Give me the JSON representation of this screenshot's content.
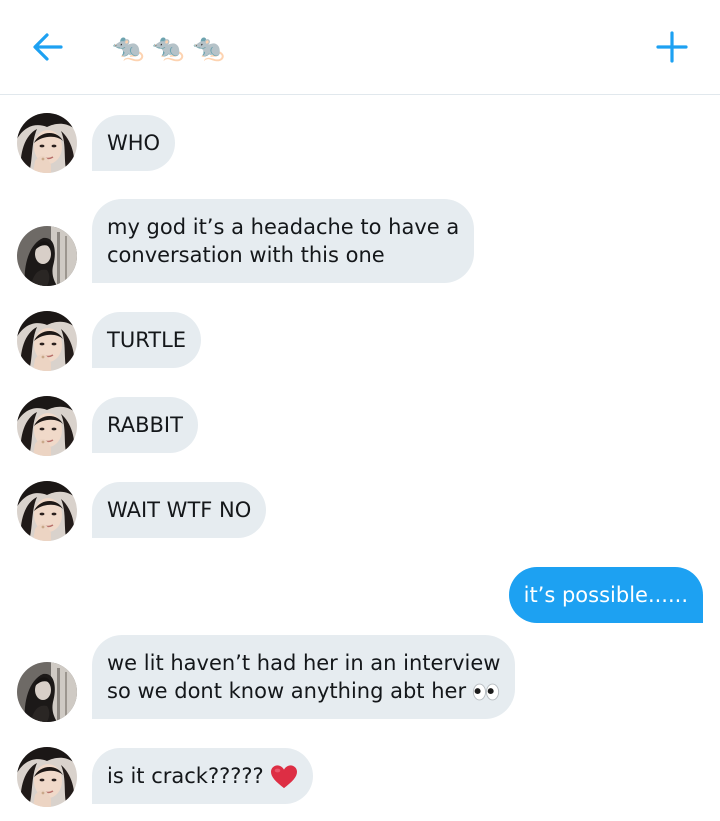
{
  "header": {
    "back_icon": "arrow-left-icon",
    "title_glyphs": [
      "🐀",
      "🐀",
      "🐀"
    ],
    "add_icon": "plus-icon",
    "accent_color": "#1da1f2"
  },
  "messages": [
    {
      "direction": "in",
      "avatar": "user-a",
      "lines": [
        "WHO"
      ]
    },
    {
      "direction": "in",
      "avatar": "user-b",
      "lines": [
        "my god it’s a headache to have a",
        "conversation with this one"
      ]
    },
    {
      "direction": "in",
      "avatar": "user-a",
      "lines": [
        "TURTLE"
      ]
    },
    {
      "direction": "in",
      "avatar": "user-a",
      "lines": [
        "RABBIT"
      ]
    },
    {
      "direction": "in",
      "avatar": "user-a",
      "lines": [
        "WAIT WTF NO"
      ]
    },
    {
      "direction": "out",
      "lines": [
        "it’s possible......"
      ]
    },
    {
      "direction": "in",
      "avatar": "user-b",
      "lines": [
        "we lit haven’t had her in an interview",
        "so we dont know anything abt her"
      ],
      "trailing_emoji": "eyes-emoji"
    },
    {
      "direction": "in",
      "avatar": "user-a",
      "lines": [
        "is it crack?????"
      ],
      "trailing_emoji": "red-heart-emoji"
    }
  ],
  "colors": {
    "incoming_bubble": "#e6ecf0",
    "outgoing_bubble": "#1da1f2",
    "text": "#14171a"
  }
}
